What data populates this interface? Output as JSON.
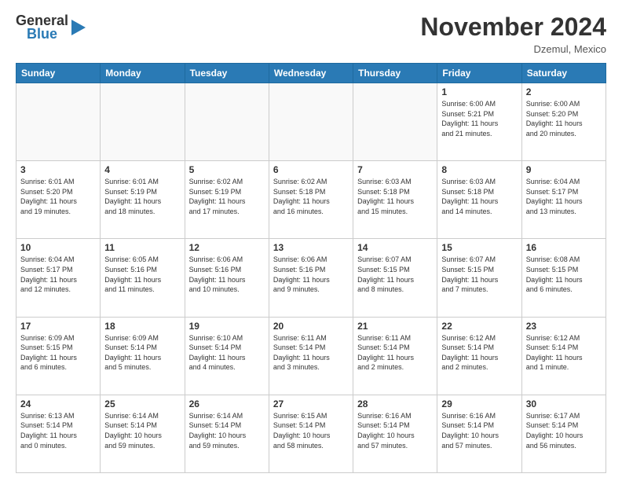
{
  "header": {
    "logo_general": "General",
    "logo_blue": "Blue",
    "month_title": "November 2024",
    "location": "Dzemul, Mexico"
  },
  "days_of_week": [
    "Sunday",
    "Monday",
    "Tuesday",
    "Wednesday",
    "Thursday",
    "Friday",
    "Saturday"
  ],
  "weeks": [
    [
      {
        "day": "",
        "info": ""
      },
      {
        "day": "",
        "info": ""
      },
      {
        "day": "",
        "info": ""
      },
      {
        "day": "",
        "info": ""
      },
      {
        "day": "",
        "info": ""
      },
      {
        "day": "1",
        "info": "Sunrise: 6:00 AM\nSunset: 5:21 PM\nDaylight: 11 hours\nand 21 minutes."
      },
      {
        "day": "2",
        "info": "Sunrise: 6:00 AM\nSunset: 5:20 PM\nDaylight: 11 hours\nand 20 minutes."
      }
    ],
    [
      {
        "day": "3",
        "info": "Sunrise: 6:01 AM\nSunset: 5:20 PM\nDaylight: 11 hours\nand 19 minutes."
      },
      {
        "day": "4",
        "info": "Sunrise: 6:01 AM\nSunset: 5:19 PM\nDaylight: 11 hours\nand 18 minutes."
      },
      {
        "day": "5",
        "info": "Sunrise: 6:02 AM\nSunset: 5:19 PM\nDaylight: 11 hours\nand 17 minutes."
      },
      {
        "day": "6",
        "info": "Sunrise: 6:02 AM\nSunset: 5:18 PM\nDaylight: 11 hours\nand 16 minutes."
      },
      {
        "day": "7",
        "info": "Sunrise: 6:03 AM\nSunset: 5:18 PM\nDaylight: 11 hours\nand 15 minutes."
      },
      {
        "day": "8",
        "info": "Sunrise: 6:03 AM\nSunset: 5:18 PM\nDaylight: 11 hours\nand 14 minutes."
      },
      {
        "day": "9",
        "info": "Sunrise: 6:04 AM\nSunset: 5:17 PM\nDaylight: 11 hours\nand 13 minutes."
      }
    ],
    [
      {
        "day": "10",
        "info": "Sunrise: 6:04 AM\nSunset: 5:17 PM\nDaylight: 11 hours\nand 12 minutes."
      },
      {
        "day": "11",
        "info": "Sunrise: 6:05 AM\nSunset: 5:16 PM\nDaylight: 11 hours\nand 11 minutes."
      },
      {
        "day": "12",
        "info": "Sunrise: 6:06 AM\nSunset: 5:16 PM\nDaylight: 11 hours\nand 10 minutes."
      },
      {
        "day": "13",
        "info": "Sunrise: 6:06 AM\nSunset: 5:16 PM\nDaylight: 11 hours\nand 9 minutes."
      },
      {
        "day": "14",
        "info": "Sunrise: 6:07 AM\nSunset: 5:15 PM\nDaylight: 11 hours\nand 8 minutes."
      },
      {
        "day": "15",
        "info": "Sunrise: 6:07 AM\nSunset: 5:15 PM\nDaylight: 11 hours\nand 7 minutes."
      },
      {
        "day": "16",
        "info": "Sunrise: 6:08 AM\nSunset: 5:15 PM\nDaylight: 11 hours\nand 6 minutes."
      }
    ],
    [
      {
        "day": "17",
        "info": "Sunrise: 6:09 AM\nSunset: 5:15 PM\nDaylight: 11 hours\nand 6 minutes."
      },
      {
        "day": "18",
        "info": "Sunrise: 6:09 AM\nSunset: 5:14 PM\nDaylight: 11 hours\nand 5 minutes."
      },
      {
        "day": "19",
        "info": "Sunrise: 6:10 AM\nSunset: 5:14 PM\nDaylight: 11 hours\nand 4 minutes."
      },
      {
        "day": "20",
        "info": "Sunrise: 6:11 AM\nSunset: 5:14 PM\nDaylight: 11 hours\nand 3 minutes."
      },
      {
        "day": "21",
        "info": "Sunrise: 6:11 AM\nSunset: 5:14 PM\nDaylight: 11 hours\nand 2 minutes."
      },
      {
        "day": "22",
        "info": "Sunrise: 6:12 AM\nSunset: 5:14 PM\nDaylight: 11 hours\nand 2 minutes."
      },
      {
        "day": "23",
        "info": "Sunrise: 6:12 AM\nSunset: 5:14 PM\nDaylight: 11 hours\nand 1 minute."
      }
    ],
    [
      {
        "day": "24",
        "info": "Sunrise: 6:13 AM\nSunset: 5:14 PM\nDaylight: 11 hours\nand 0 minutes."
      },
      {
        "day": "25",
        "info": "Sunrise: 6:14 AM\nSunset: 5:14 PM\nDaylight: 10 hours\nand 59 minutes."
      },
      {
        "day": "26",
        "info": "Sunrise: 6:14 AM\nSunset: 5:14 PM\nDaylight: 10 hours\nand 59 minutes."
      },
      {
        "day": "27",
        "info": "Sunrise: 6:15 AM\nSunset: 5:14 PM\nDaylight: 10 hours\nand 58 minutes."
      },
      {
        "day": "28",
        "info": "Sunrise: 6:16 AM\nSunset: 5:14 PM\nDaylight: 10 hours\nand 57 minutes."
      },
      {
        "day": "29",
        "info": "Sunrise: 6:16 AM\nSunset: 5:14 PM\nDaylight: 10 hours\nand 57 minutes."
      },
      {
        "day": "30",
        "info": "Sunrise: 6:17 AM\nSunset: 5:14 PM\nDaylight: 10 hours\nand 56 minutes."
      }
    ]
  ]
}
